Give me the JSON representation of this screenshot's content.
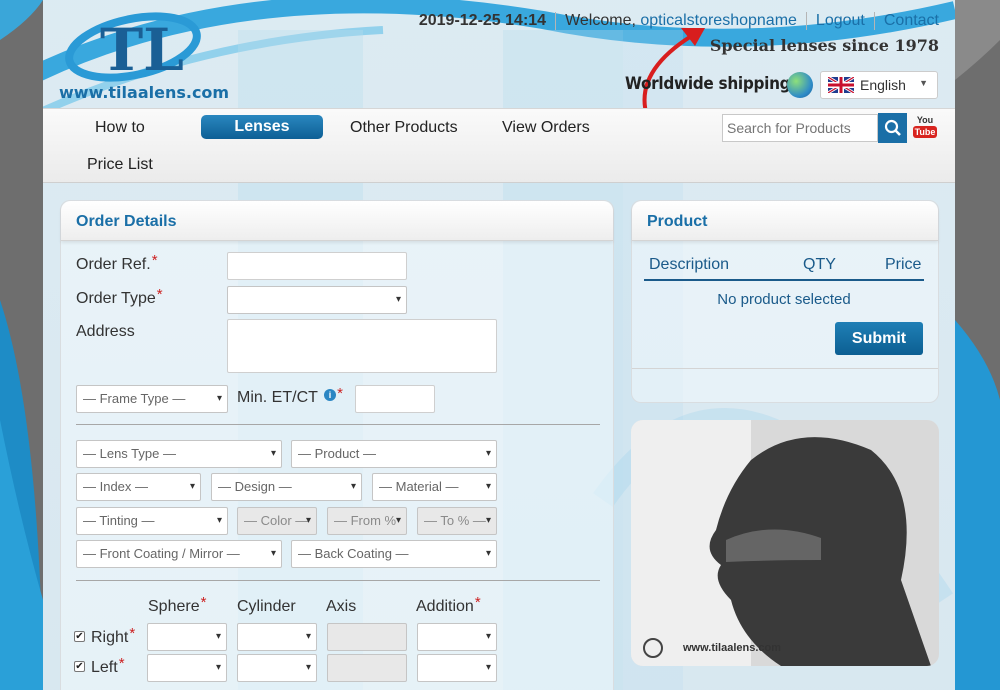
{
  "site": {
    "logo_text": "www.tilaalens.com",
    "logo_letters": "TL"
  },
  "topbar": {
    "datetime": "2019-12-25 14:14",
    "welcome_prefix": "Welcome,",
    "username": "opticalstoreshopname",
    "logout": "Logout",
    "contact": "Contact"
  },
  "tagline": "Special lenses since 1978",
  "shipping": "Worldwide shipping",
  "language": {
    "selected": "English"
  },
  "nav": {
    "items": [
      "How to",
      "Lenses",
      "Other Products",
      "View Orders",
      "Price List"
    ],
    "active": "Lenses",
    "search_placeholder": "Search for Products",
    "youtube_top": "You",
    "youtube_bottom": "Tube"
  },
  "order": {
    "title": "Order Details",
    "ref_label": "Order Ref.",
    "type_label": "Order Type",
    "address_label": "Address",
    "frame_type": "— Frame Type —",
    "min_label": "Min. ET/CT",
    "required_mark": "*",
    "info_glyph": "i",
    "lens_type": "— Lens Type —",
    "product": "— Product —",
    "index": "— Index —",
    "design": "— Design —",
    "material": "— Material —",
    "tinting": "— Tinting —",
    "color": "— Color —",
    "from": "— From %",
    "to": "— To % —",
    "front_coating": "— Front Coating / Mirror —",
    "back_coating": "— Back Coating —",
    "columns": [
      "Sphere",
      "Cylinder",
      "Axis",
      "Addition"
    ],
    "right_label": "Right",
    "left_label": "Left",
    "check_glyph": "✔"
  },
  "product_panel": {
    "title": "Product",
    "headers": [
      "Description",
      "QTY",
      "Price"
    ],
    "empty_text": "No product selected",
    "submit": "Submit"
  },
  "photo_caption": "www.tilaalens.com",
  "colors": {
    "accent": "#1a6fa7",
    "required": "#cc1f1f",
    "button": "#0d5f95"
  }
}
